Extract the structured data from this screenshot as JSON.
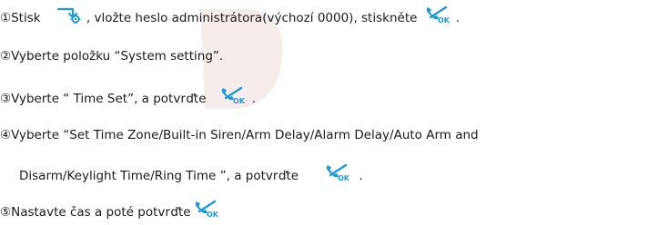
{
  "steps": [
    {
      "number": "①",
      "before": "Stisk",
      "middle": ", vložte heslo administrátora(výchozí 0000), stiskněte",
      "after": " .",
      "icons": [
        "settings-arrow-icon",
        "ok-phone-icon"
      ]
    },
    {
      "number": "②",
      "text": "Vyberte položku “System setting”."
    },
    {
      "number": "③",
      "before": "Vyberte “ Time Set”, a potvrďte",
      "after": " .",
      "icons": [
        "ok-phone-icon"
      ]
    },
    {
      "number": "④",
      "line1": "Vyberte “Set Time Zone/Built-in Siren/Arm Delay/Alarm Delay/Auto Arm and",
      "line2": "Disarm/Keylight Time/Ring Time  ”, a potvrďte",
      "after": " .",
      "icons": [
        "ok-phone-icon"
      ]
    },
    {
      "number": "⑤",
      "before": "Nastavte čas a poté potvrďte",
      "icons": [
        "ok-phone-icon"
      ]
    }
  ],
  "icon_labels": {
    "ok": "OK"
  },
  "colors": {
    "text": "#1a1a1a",
    "icon_blue": "#1e9ad6",
    "watermark": "#f1dcdc"
  }
}
